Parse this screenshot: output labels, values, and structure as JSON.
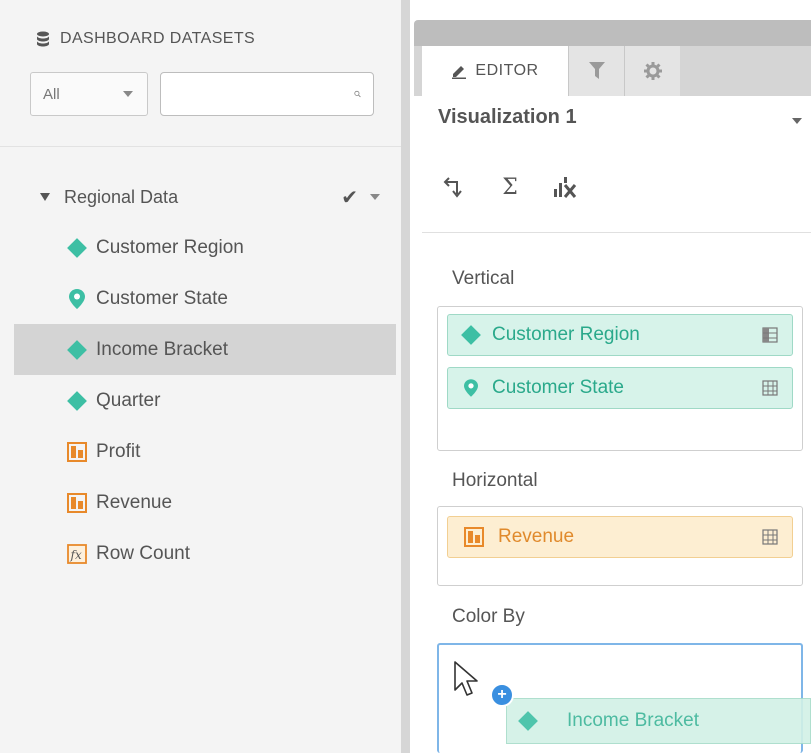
{
  "datasets_panel": {
    "header": "DASHBOARD DATASETS",
    "filter_select": "All",
    "search_value": "",
    "group": {
      "name": "Regional Data",
      "fields": [
        {
          "label": "Customer Region",
          "icon": "diamond-icon",
          "type": "dimension"
        },
        {
          "label": "Customer State",
          "icon": "location-pin-icon",
          "type": "geo"
        },
        {
          "label": "Income Bracket",
          "icon": "diamond-icon",
          "type": "dimension",
          "selected": true
        },
        {
          "label": "Quarter",
          "icon": "diamond-icon",
          "type": "dimension"
        },
        {
          "label": "Profit",
          "icon": "measure-icon",
          "type": "measure"
        },
        {
          "label": "Revenue",
          "icon": "measure-icon",
          "type": "measure"
        },
        {
          "label": "Row Count",
          "icon": "formula-icon",
          "type": "calculated"
        }
      ]
    }
  },
  "editor": {
    "tabs": [
      {
        "label": "EDITOR",
        "icon": "pencil-icon",
        "active": true
      },
      {
        "label": "",
        "icon": "filter-icon"
      },
      {
        "label": "",
        "icon": "gear-icon"
      }
    ],
    "visualization_title": "Visualization 1",
    "toolbar": [
      "swap-axes-icon",
      "sum-icon",
      "clear-chart-icon"
    ],
    "sections": {
      "vertical": {
        "label": "Vertical",
        "pills": [
          "Customer Region",
          "Customer State"
        ]
      },
      "horizontal": {
        "label": "Horizontal",
        "pills": [
          "Revenue"
        ]
      },
      "color_by": {
        "label": "Color By",
        "pills": []
      }
    },
    "drag_item": "Income Bracket"
  },
  "colors": {
    "dimension": "#3dbfa4",
    "measure": "#e8892a",
    "drop_highlight": "#7fb6e8",
    "selected_row": "#d4d4d4"
  }
}
